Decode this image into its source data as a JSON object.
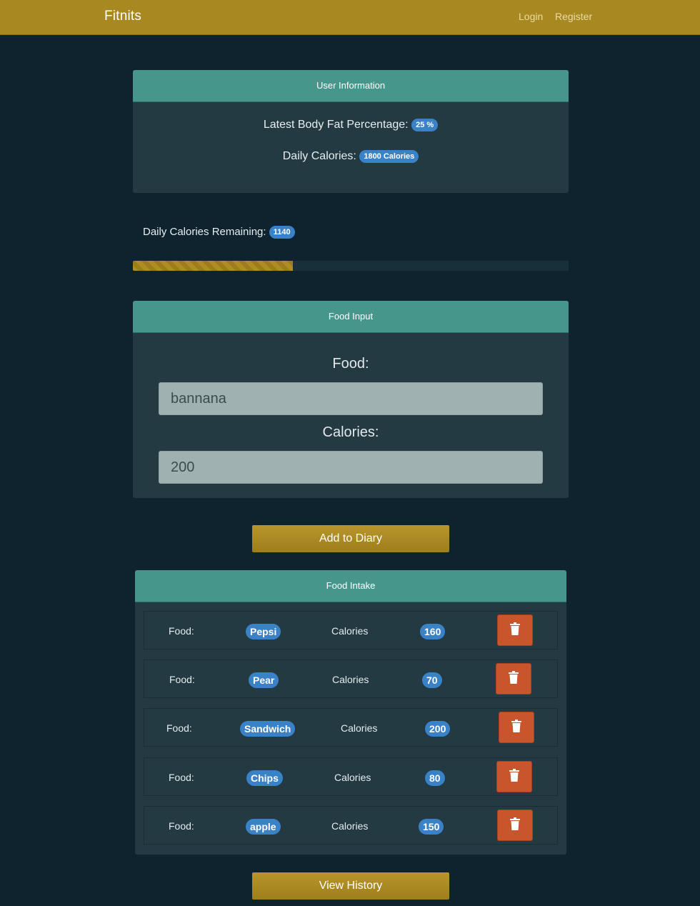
{
  "navbar": {
    "brand": "Fitnits",
    "login": "Login",
    "register": "Register"
  },
  "user_info": {
    "header": "User Information",
    "fat_label": "Latest Body Fat Percentage:",
    "fat_value": "25 %",
    "calories_label": "Daily Calories:",
    "calories_value": "1800 Calories"
  },
  "remaining": {
    "label": "Daily Calories Remaining:",
    "value": "1140",
    "progress_fraction": 0.367
  },
  "food_input": {
    "header": "Food Input",
    "food_label": "Food:",
    "food_value": "bannana",
    "calories_label": "Calories:",
    "calories_value": "200"
  },
  "buttons": {
    "add": "Add to Diary",
    "history": "View History"
  },
  "intake": {
    "header": "Food Intake",
    "food_label": "Food:",
    "calories_label": "Calories",
    "items": [
      {
        "food": "Pepsi",
        "calories": "160"
      },
      {
        "food": "Pear",
        "calories": "70"
      },
      {
        "food": "Sandwich",
        "calories": "200"
      },
      {
        "food": "Chips",
        "calories": "80"
      },
      {
        "food": "apple",
        "calories": "150"
      }
    ]
  },
  "colors": {
    "navbar": "#a88820",
    "card_header": "#46968c",
    "badge": "#3a82c8",
    "delete": "#c9552c",
    "background": "#0e232e"
  },
  "icons": {
    "delete": "trash-icon"
  }
}
